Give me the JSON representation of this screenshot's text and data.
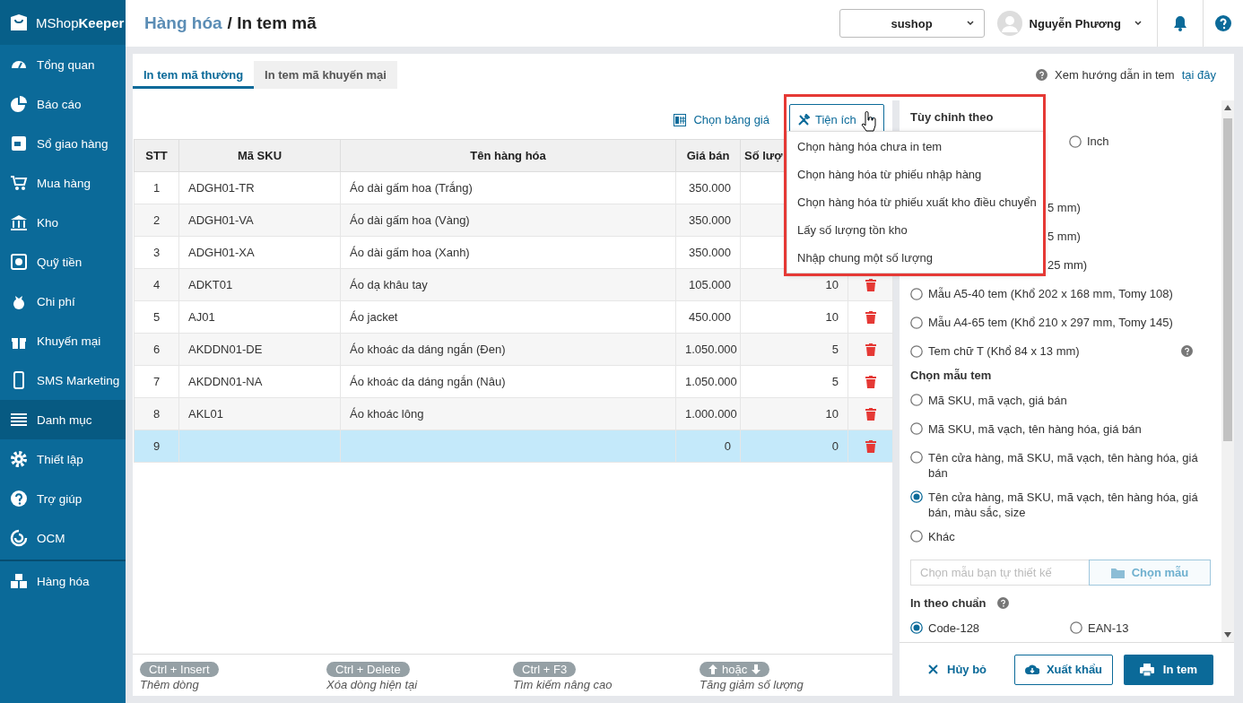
{
  "brand": {
    "name": "MShop**Keeper**"
  },
  "sidebar": {
    "items": [
      {
        "label": "Tổng quan",
        "selected": false
      },
      {
        "label": "Báo cáo",
        "selected": false
      },
      {
        "label": "Sổ giao hàng",
        "selected": false
      },
      {
        "label": "Mua hàng",
        "selected": false
      },
      {
        "label": "Kho",
        "selected": false
      },
      {
        "label": "Quỹ tiền",
        "selected": false
      },
      {
        "label": "Chi phí",
        "selected": false
      },
      {
        "label": "Khuyến mại",
        "selected": false
      },
      {
        "label": "SMS Marketing",
        "selected": false
      },
      {
        "label": "Danh mục",
        "selected": true
      },
      {
        "label": "Thiết lập",
        "selected": false
      },
      {
        "label": "Trợ giúp",
        "selected": false
      },
      {
        "label": "OCM",
        "selected": false
      }
    ],
    "bottom_items": [
      {
        "label": "Hàng hóa",
        "selected": false
      }
    ]
  },
  "header": {
    "breadcrumb_parent": "Hàng hóa",
    "separator": "/",
    "title": "In tem mã",
    "shop_select": "sushop",
    "user_name": "Nguyễn Phương"
  },
  "tabs": [
    {
      "label": "In tem mã thường",
      "selected": true
    },
    {
      "label": "In tem mã khuyến mại",
      "selected": false
    }
  ],
  "help_link": {
    "text": "Xem hướng dẫn in tem",
    "link": "tại đây"
  },
  "toolbar": {
    "price_table": "Chọn bảng giá",
    "utilities": "Tiện ích"
  },
  "table": {
    "columns": [
      "STT",
      "Mã SKU",
      "Tên hàng hóa",
      "Giá bán",
      "Số lượ"
    ],
    "rows": [
      {
        "stt": "1",
        "sku": "ADGH01-TR",
        "name": "Áo dài gấm hoa (Trắng)",
        "price": "350.000",
        "selected": false
      },
      {
        "stt": "2",
        "sku": "ADGH01-VA",
        "name": "Áo dài gấm hoa (Vàng)",
        "price": "350.000",
        "selected": false
      },
      {
        "stt": "3",
        "sku": "ADGH01-XA",
        "name": "Áo dài gấm hoa (Xanh)",
        "price": "350.000",
        "selected": false
      },
      {
        "stt": "4",
        "sku": "ADKT01",
        "name": "Áo dạ khâu tay",
        "price": "105.000",
        "quantity": "10",
        "selected": false
      },
      {
        "stt": "5",
        "sku": "AJ01",
        "name": "Áo jacket",
        "price": "450.000",
        "quantity": "10",
        "selected": false
      },
      {
        "stt": "6",
        "sku": "AKDDN01-DE",
        "name": "Áo khoác da dáng ngắn (Đen)",
        "price": "1.050.000",
        "quantity": "5",
        "selected": false
      },
      {
        "stt": "7",
        "sku": "AKDDN01-NA",
        "name": "Áo khoác da dáng ngắn (Nâu)",
        "price": "1.050.000",
        "quantity": "5",
        "selected": false
      },
      {
        "stt": "8",
        "sku": "AKL01",
        "name": "Áo khoác lông",
        "price": "1.000.000",
        "quantity": "10",
        "selected": false
      },
      {
        "stt": "9",
        "price": "0",
        "quantity": "0",
        "selected": true
      }
    ]
  },
  "shortcuts": [
    {
      "kind": "keys",
      "keys": "Ctrl + Insert",
      "description": "Thêm dòng"
    },
    {
      "kind": "keys",
      "keys": "Ctrl + Delete",
      "description": "Xóa dòng hiện tại"
    },
    {
      "kind": "keys",
      "keys": "Ctrl + F3",
      "description": "Tìm kiếm nâng cao"
    },
    {
      "kind": "arrows",
      "keys": "hoặc",
      "description": "Tăng giảm số lượng"
    }
  ],
  "utilities_menu": {
    "items": [
      "Chọn hàng hóa chưa in tem",
      "Chọn hàng hóa từ phiếu nhập hàng",
      "Chọn hàng hóa từ phiếu xuất kho điều chuyển",
      "Lấy số lượng tồn kho",
      "Nhập chung một số lượng"
    ]
  },
  "settings": {
    "unit_title": "Tùy chỉnh theo",
    "unit_options": [
      {
        "label": "Inch",
        "selected": false
      }
    ],
    "size_options": [
      {
        "kind": "partial",
        "label": "5 mm)"
      },
      {
        "kind": "partial",
        "label": "5 mm)"
      },
      {
        "kind": "partial",
        "label": "25 mm)"
      },
      {
        "kind": "radio",
        "label": "Mẫu A5-40 tem (Khổ 202 x 168 mm, Tomy 108)",
        "selected": false,
        "help": false
      },
      {
        "kind": "radio",
        "label": "Mẫu A4-65 tem (Khổ 210 x 297 mm, Tomy 145)",
        "selected": false,
        "help": false
      },
      {
        "kind": "radio",
        "label": "Tem chữ T (Khổ 84 x 13 mm)",
        "selected": false,
        "help": true
      }
    ],
    "template_title": "Chọn mẫu tem",
    "template_options": [
      {
        "label": "Mã SKU, mã vạch, giá bán",
        "selected": false
      },
      {
        "label": "Mã SKU, mã vạch, tên hàng hóa, giá bán",
        "selected": false
      },
      {
        "label": "Tên cửa hàng, mã SKU, mã vạch, tên hàng hóa, giá bán",
        "selected": false
      },
      {
        "label": "Tên cửa hàng, mã SKU, mã vạch, tên hàng hóa, giá bán, màu sắc, size",
        "selected": true
      },
      {
        "label": "Khác",
        "selected": false
      }
    ],
    "custom_template": {
      "placeholder": "Chọn mẫu bạn tự thiết kế",
      "button": "Chọn mẫu"
    },
    "standard_title": "In theo chuẩn",
    "standard_options": [
      {
        "label": "Code-128",
        "selected": true
      },
      {
        "label": "EAN-13",
        "selected": false
      }
    ]
  },
  "actions": {
    "cancel": "Hủy bỏ",
    "export": "Xuất khẩu",
    "print": "In tem"
  }
}
